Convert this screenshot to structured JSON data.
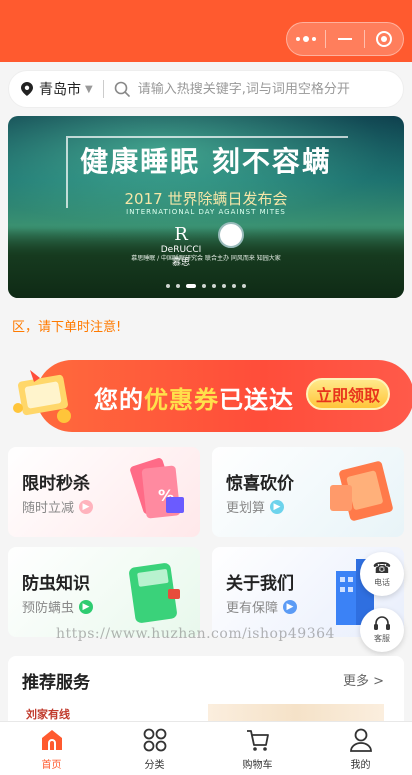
{
  "nav": {
    "more_icon": "more-dots-icon",
    "minimize_icon": "minimize-icon",
    "close_icon": "target-close-icon"
  },
  "location": {
    "city": "青岛市"
  },
  "search": {
    "placeholder": "请输入热搜关键字,词与词用空格分开"
  },
  "banner": {
    "title": "健康睡眠 刻不容螨",
    "subtitle": "2017 世界除螨日发布会",
    "subtitle_en": "INTERNATIONAL DAY AGAINST MITES",
    "brand": "DeRUCCI 慕思",
    "footnote": "慕思睡眠 / 中国睡眠研究会 联合主办  同风而来 知园大家",
    "slide_count": 8,
    "active_slide": 2
  },
  "notice": "区，请下单时注意!",
  "coupon": {
    "text_pre": "您的",
    "text_highlight": "优惠券",
    "text_post": "已送达",
    "button": "立即领取"
  },
  "cards": [
    {
      "title": "限时秒杀",
      "subtitle": "随时立减",
      "accent": "#ff9aa8"
    },
    {
      "title": "惊喜砍价",
      "subtitle": "更划算",
      "accent": "#4fc3e0"
    },
    {
      "title": "防虫知识",
      "subtitle": "预防螨虫",
      "accent": "#2ecc71"
    },
    {
      "title": "关于我们",
      "subtitle": "更有保障",
      "accent": "#3b82f6"
    }
  ],
  "float": {
    "phone_label": "电话",
    "service_label": "客服"
  },
  "watermark": "https://www.huzhan.com/ishop49364",
  "recommend": {
    "title": "推荐服务",
    "more": "更多 >",
    "logo_text": "刘家有线"
  },
  "tabs": [
    {
      "label": "首页",
      "icon": "home-icon",
      "active": true
    },
    {
      "label": "分类",
      "icon": "category-icon",
      "active": false
    },
    {
      "label": "购物车",
      "icon": "cart-icon",
      "active": false
    },
    {
      "label": "我的",
      "icon": "user-icon",
      "active": false
    }
  ],
  "colors": {
    "brand": "#ff5a2f",
    "notice": "#ff7a00"
  }
}
